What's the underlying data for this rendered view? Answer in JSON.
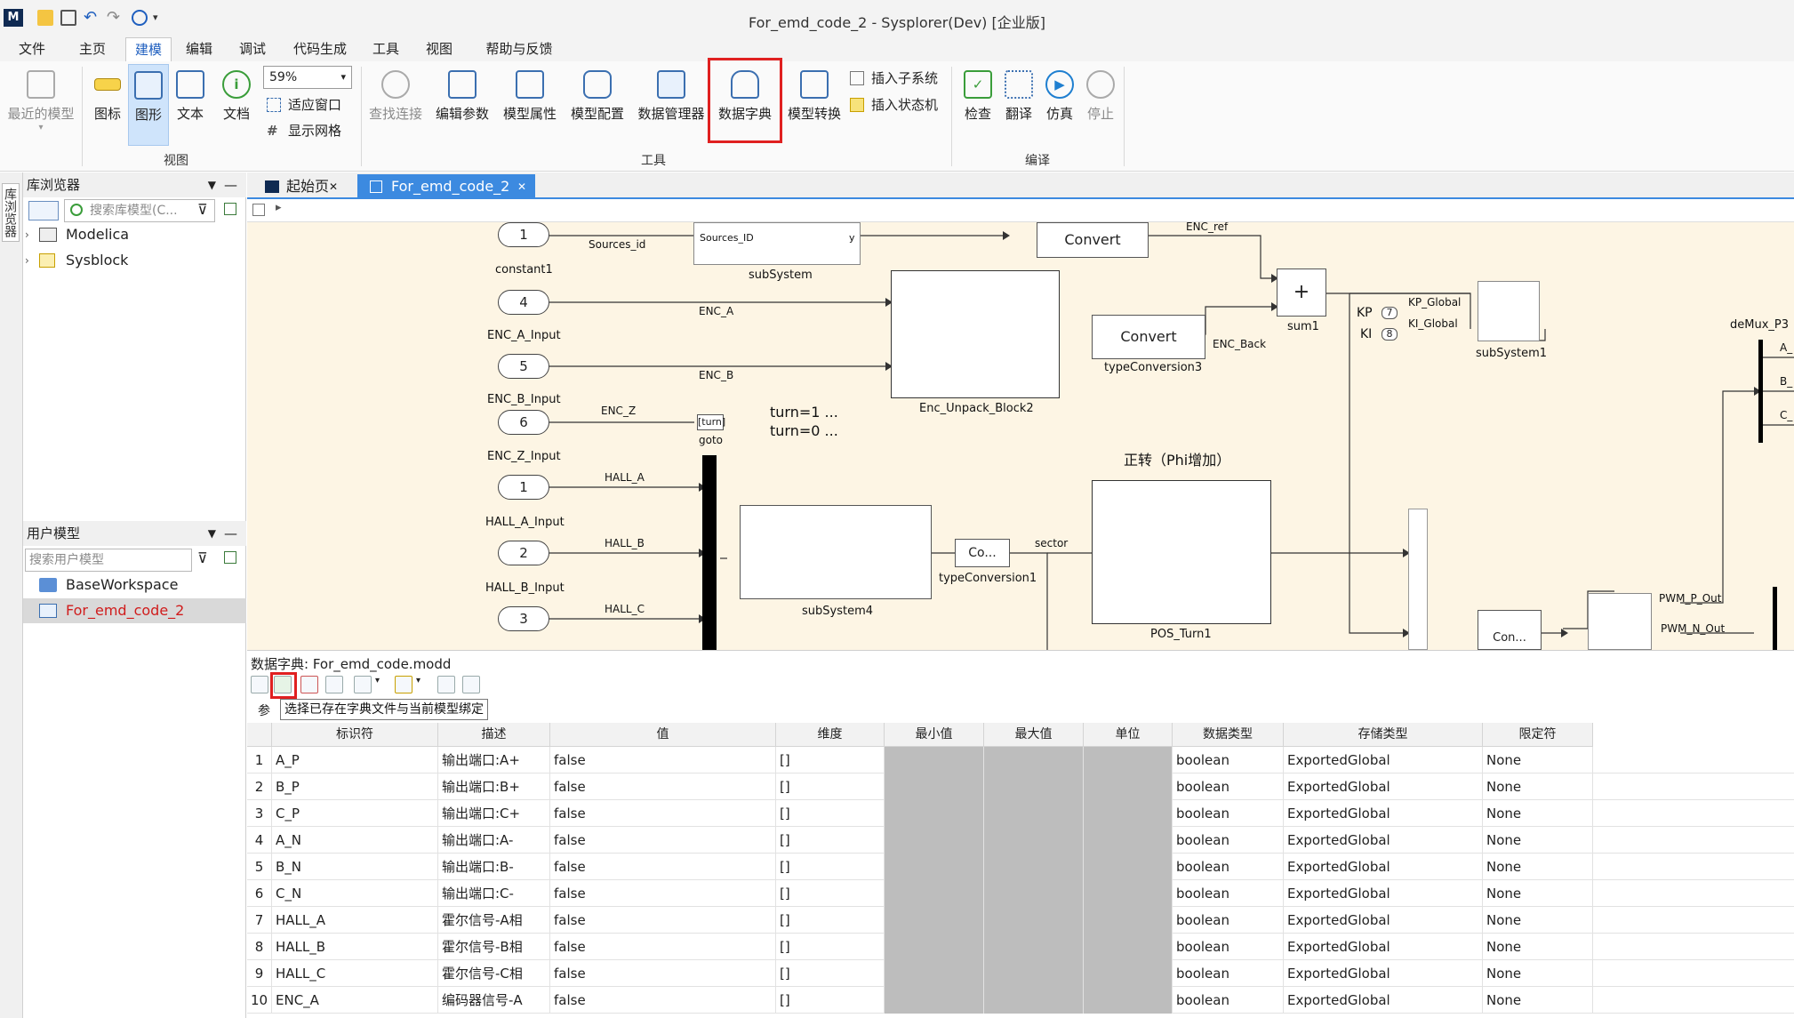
{
  "window": {
    "title": "For_emd_code_2 - Sysplorer(Dev) [企业版]"
  },
  "menubar": {
    "items": [
      "文件",
      "主页",
      "建模",
      "编辑",
      "调试",
      "代码生成",
      "工具",
      "视图",
      "帮助与反馈"
    ],
    "active": "建模"
  },
  "ribbon": {
    "recent": "最近的模型",
    "icon": "图标",
    "graphic": "图形",
    "text": "文本",
    "doc": "文档",
    "zoom_value": "59%",
    "fit_window": "适应窗口",
    "show_grid": "显示网格",
    "group_view": "视图",
    "find_connection": "查找连接",
    "edit_params": "编辑参数",
    "model_props": "模型属性",
    "model_config": "模型配置",
    "data_manager": "数据管理器",
    "data_dict": "数据字典",
    "model_convert": "模型转换",
    "insert_subsystem": "插入子系统",
    "insert_statemachine": "插入状态机",
    "group_tools": "工具",
    "check": "检查",
    "translate": "翻译",
    "simulate": "仿真",
    "stop": "停止",
    "group_compile": "编译"
  },
  "left": {
    "strip_label": "库浏览器",
    "lib_title": "库浏览器",
    "lib_search_placeholder": "搜索库模型(C...",
    "lib_items": [
      "Modelica",
      "Sysblock"
    ],
    "user_title": "用户模型",
    "user_search_placeholder": "搜索用户模型",
    "user_items": [
      "BaseWorkspace",
      "For_emd_code_2"
    ]
  },
  "tabs": {
    "start": "起始页",
    "doc": "For_emd_code_2"
  },
  "diagram": {
    "pills": [
      "1",
      "4",
      "5",
      "6",
      "1",
      "2",
      "3"
    ],
    "pill_labels": [
      "constant1",
      "ENC_A_Input",
      "ENC_B_Input",
      "ENC_Z_Input",
      "HALL_A_Input",
      "HALL_B_Input",
      "HALL_C_Input"
    ],
    "signals": [
      "Sources_id",
      "ENC_A",
      "ENC_B",
      "ENC_Z",
      "HALL_A",
      "HALL_B",
      "HALL_C",
      "ENC_ref",
      "ENC_Back",
      "KP_Global",
      "KI_Global",
      "sector"
    ],
    "blocks": {
      "subsystem": "subSystem",
      "subsystem_inner_in": "Sources_ID",
      "subsystem_inner_out": "y",
      "convert1": "Convert",
      "convert2": "Convert",
      "typeconv3": "typeConversion3",
      "enc_unpack": "Enc_Unpack_Block2",
      "sum1": "sum1",
      "sum_sign": "+",
      "subsystem1": "subSystem1",
      "kp": "KP",
      "ki": "KI",
      "kp_val": "7",
      "ki_val": "8",
      "demux": "deMux_P3",
      "demux_outs": [
        "A_",
        "B_",
        "C_"
      ],
      "goto": "goto",
      "goto_tag": "[turn]",
      "turn1": "turn=1 ...",
      "turn0": "turn=0 ...",
      "forward": "正转（Phi增加）",
      "subsystem4": "subSystem4",
      "co": "Co...",
      "typeconv1": "typeConversion1",
      "pos_turn": "POS_Turn1",
      "con": "Con...",
      "pwm_p": "PWM_P_Out",
      "pwm_n": "PWM_N_Out"
    }
  },
  "dict": {
    "title": "数据字典: For_emd_code.modd",
    "tooltip": "选择已存在字典文件与当前模型绑定",
    "tab_hint": "参",
    "columns": [
      "标识符",
      "描述",
      "值",
      "维度",
      "最小值",
      "最大值",
      "单位",
      "数据类型",
      "存储类型",
      "限定符"
    ],
    "rows": [
      {
        "n": "1",
        "id": "A_P",
        "desc": "输出端口:A+",
        "val": "false",
        "dim": "[]",
        "type": "boolean",
        "storage": "ExportedGlobal",
        "qual": "None"
      },
      {
        "n": "2",
        "id": "B_P",
        "desc": "输出端口:B+",
        "val": "false",
        "dim": "[]",
        "type": "boolean",
        "storage": "ExportedGlobal",
        "qual": "None"
      },
      {
        "n": "3",
        "id": "C_P",
        "desc": "输出端口:C+",
        "val": "false",
        "dim": "[]",
        "type": "boolean",
        "storage": "ExportedGlobal",
        "qual": "None"
      },
      {
        "n": "4",
        "id": "A_N",
        "desc": "输出端口:A-",
        "val": "false",
        "dim": "[]",
        "type": "boolean",
        "storage": "ExportedGlobal",
        "qual": "None"
      },
      {
        "n": "5",
        "id": "B_N",
        "desc": "输出端口:B-",
        "val": "false",
        "dim": "[]",
        "type": "boolean",
        "storage": "ExportedGlobal",
        "qual": "None"
      },
      {
        "n": "6",
        "id": "C_N",
        "desc": "输出端口:C-",
        "val": "false",
        "dim": "[]",
        "type": "boolean",
        "storage": "ExportedGlobal",
        "qual": "None"
      },
      {
        "n": "7",
        "id": "HALL_A",
        "desc": "霍尔信号-A相",
        "val": "false",
        "dim": "[]",
        "type": "boolean",
        "storage": "ExportedGlobal",
        "qual": "None"
      },
      {
        "n": "8",
        "id": "HALL_B",
        "desc": "霍尔信号-B相",
        "val": "false",
        "dim": "[]",
        "type": "boolean",
        "storage": "ExportedGlobal",
        "qual": "None"
      },
      {
        "n": "9",
        "id": "HALL_C",
        "desc": "霍尔信号-C相",
        "val": "false",
        "dim": "[]",
        "type": "boolean",
        "storage": "ExportedGlobal",
        "qual": "None"
      },
      {
        "n": "10",
        "id": "ENC_A",
        "desc": "编码器信号-A",
        "val": "false",
        "dim": "[]",
        "type": "boolean",
        "storage": "ExportedGlobal",
        "qual": "None"
      }
    ]
  },
  "colors": {
    "accent": "#1f5fbf",
    "canvas": "#fdf5e4",
    "highlight": "#e02020",
    "selected_user_model": "#d9d9d9"
  }
}
